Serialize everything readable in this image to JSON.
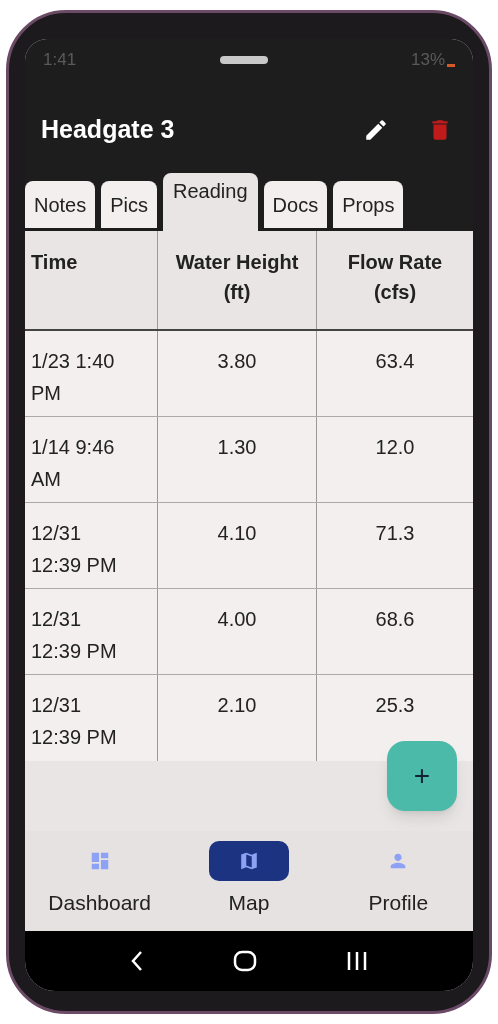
{
  "status_bar": {
    "time": "1:41",
    "battery": "13%"
  },
  "header": {
    "title": "Headgate 3"
  },
  "tabs": [
    {
      "label": "Notes",
      "selected": false
    },
    {
      "label": "Pics",
      "selected": false
    },
    {
      "label": "Reading",
      "selected": true
    },
    {
      "label": "Docs",
      "selected": false
    },
    {
      "label": "Props",
      "selected": false
    }
  ],
  "table": {
    "columns": [
      "Time",
      "Water Height (ft)",
      "Flow Rate (cfs)"
    ],
    "rows": [
      [
        "1/23 1:40 PM",
        "3.80",
        "63.4"
      ],
      [
        "1/14 9:46 AM",
        "1.30",
        "12.0"
      ],
      [
        "12/31 12:39 PM",
        "4.10",
        "71.3"
      ],
      [
        "12/31 12:39 PM",
        "4.00",
        "68.6"
      ],
      [
        "12/31 12:39 PM",
        "2.10",
        "25.3"
      ]
    ]
  },
  "fab": {
    "label": "+"
  },
  "bottom_nav": [
    {
      "label": "Dashboard",
      "kind": "dashboard",
      "selected": false
    },
    {
      "label": "Map",
      "kind": "map",
      "selected": true
    },
    {
      "label": "Profile",
      "kind": "profile",
      "selected": false
    }
  ]
}
